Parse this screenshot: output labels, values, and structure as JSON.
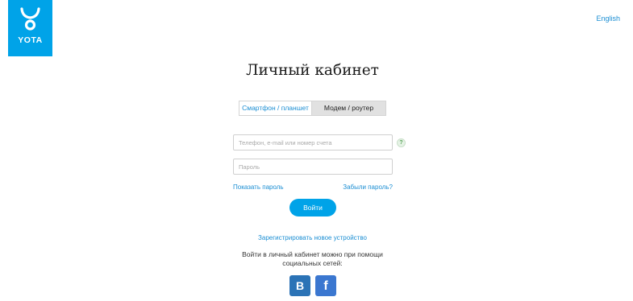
{
  "brand": {
    "logo_text": "YOTA",
    "color": "#00a3e8"
  },
  "header": {
    "language_link": "English"
  },
  "page": {
    "title": "Личный кабинет"
  },
  "tabs": [
    {
      "label": "Смартфон / планшет",
      "active": false
    },
    {
      "label": "Модем / роутер",
      "active": true
    }
  ],
  "form": {
    "login_placeholder": "Телефон, e-mail или номер счета",
    "login_value": "",
    "password_placeholder": "Пароль",
    "password_value": "",
    "help_icon_glyph": "?",
    "show_password_label": "Показать пароль",
    "forgot_password_label": "Забыли пароль?",
    "submit_label": "Войти"
  },
  "register": {
    "link_label": "Зарегистрировать новое устройство"
  },
  "social": {
    "text_line1": "Войти в личный кабинет можно при помощи",
    "text_line2": "социальных сетей:",
    "networks": [
      {
        "icon": "vk-icon",
        "glyph": "В",
        "color": "#2b73b6"
      },
      {
        "icon": "facebook-icon",
        "glyph": "f",
        "color": "#3b77d0"
      }
    ]
  }
}
